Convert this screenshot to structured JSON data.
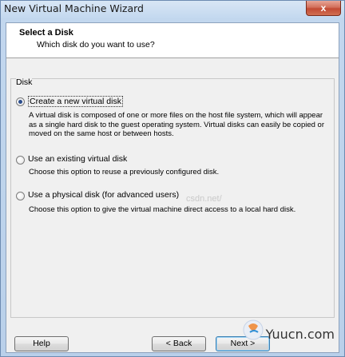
{
  "window": {
    "title": "New Virtual Machine Wizard",
    "close_glyph": "x"
  },
  "header": {
    "title": "Select a Disk",
    "subtitle": "Which disk do you want to use?"
  },
  "group": {
    "label": "Disk"
  },
  "options": [
    {
      "label": "Create a new virtual disk",
      "selected": true,
      "description": "A virtual disk is composed of one or more files on the host file system, which will appear as a single hard disk to the guest operating system. Virtual disks can easily be copied or moved on the same host or between hosts."
    },
    {
      "label": "Use an existing virtual disk",
      "selected": false,
      "description": "Choose this option to reuse a previously configured disk."
    },
    {
      "label": "Use a physical disk (for advanced users)",
      "selected": false,
      "description": "Choose this option to give the virtual machine direct access to a local hard disk."
    }
  ],
  "buttons": {
    "help": "Help",
    "back": "< Back",
    "next": "Next >"
  },
  "watermark": {
    "text": "csdn.net/"
  },
  "logo": {
    "text": "Yuucn.com"
  }
}
